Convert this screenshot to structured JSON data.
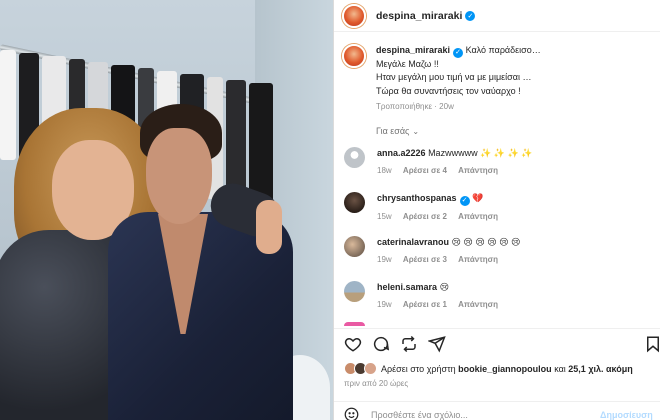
{
  "post": {
    "username": "despina_miraraki",
    "caption_lines": [
      "Καλό παράδεισο…",
      "Μεγάλε Μαζω !!",
      "Ηταν μεγάλη μου τιμή να με μιμείσαι …",
      "Τώρα θα συναντήσεις τον ναύαρχο !"
    ],
    "caption_meta": "Τροποποιήθηκε · 20w",
    "translate_label": "Για εσάς"
  },
  "comments": [
    {
      "username": "anna.a2226",
      "verified": false,
      "text": "Mazwwwww ✨ ✨ ✨ ✨",
      "time": "18w",
      "likes": "Αρέσει σε 4",
      "reply": "Απάντηση",
      "avatar_color": "#bfc4c9"
    },
    {
      "username": "chrysanthospanas",
      "verified": true,
      "text": "💔",
      "time": "15w",
      "likes": "Αρέσει σε 2",
      "reply": "Απάντηση",
      "avatar_color": "#3a2d26"
    },
    {
      "username": "caterinalavranou",
      "verified": false,
      "text": "😢 😢 😢 😢 😢 😢",
      "time": "19w",
      "likes": "Αρέσει σε 3",
      "reply": "Απάντηση",
      "avatar_color": "#9a8a7a"
    },
    {
      "username": "heleni.samara",
      "verified": false,
      "text": "😢",
      "time": "19w",
      "likes": "Αρέσει σε 1",
      "reply": "Απάντηση",
      "avatar_color": "#8fa6b8"
    }
  ],
  "likes": {
    "prefix": "Αρέσει στο χρήστη",
    "user": "bookie_giannopoulou",
    "joiner": "και",
    "count": "25,1 χιλ. ακόμη"
  },
  "time_ago": "πριν από 20 ώρες",
  "composer": {
    "placeholder": "Προσθέστε ένα σχόλιο...",
    "post_label": "Δημοσίευση"
  },
  "icons": [
    "heart-icon",
    "comment-icon",
    "share-icon",
    "send-icon",
    "bookmark-icon",
    "emoji-icon"
  ],
  "colors": {
    "verified": "#0095f6",
    "muted": "#8e8e8e",
    "post_disabled": "#b3dbff"
  }
}
